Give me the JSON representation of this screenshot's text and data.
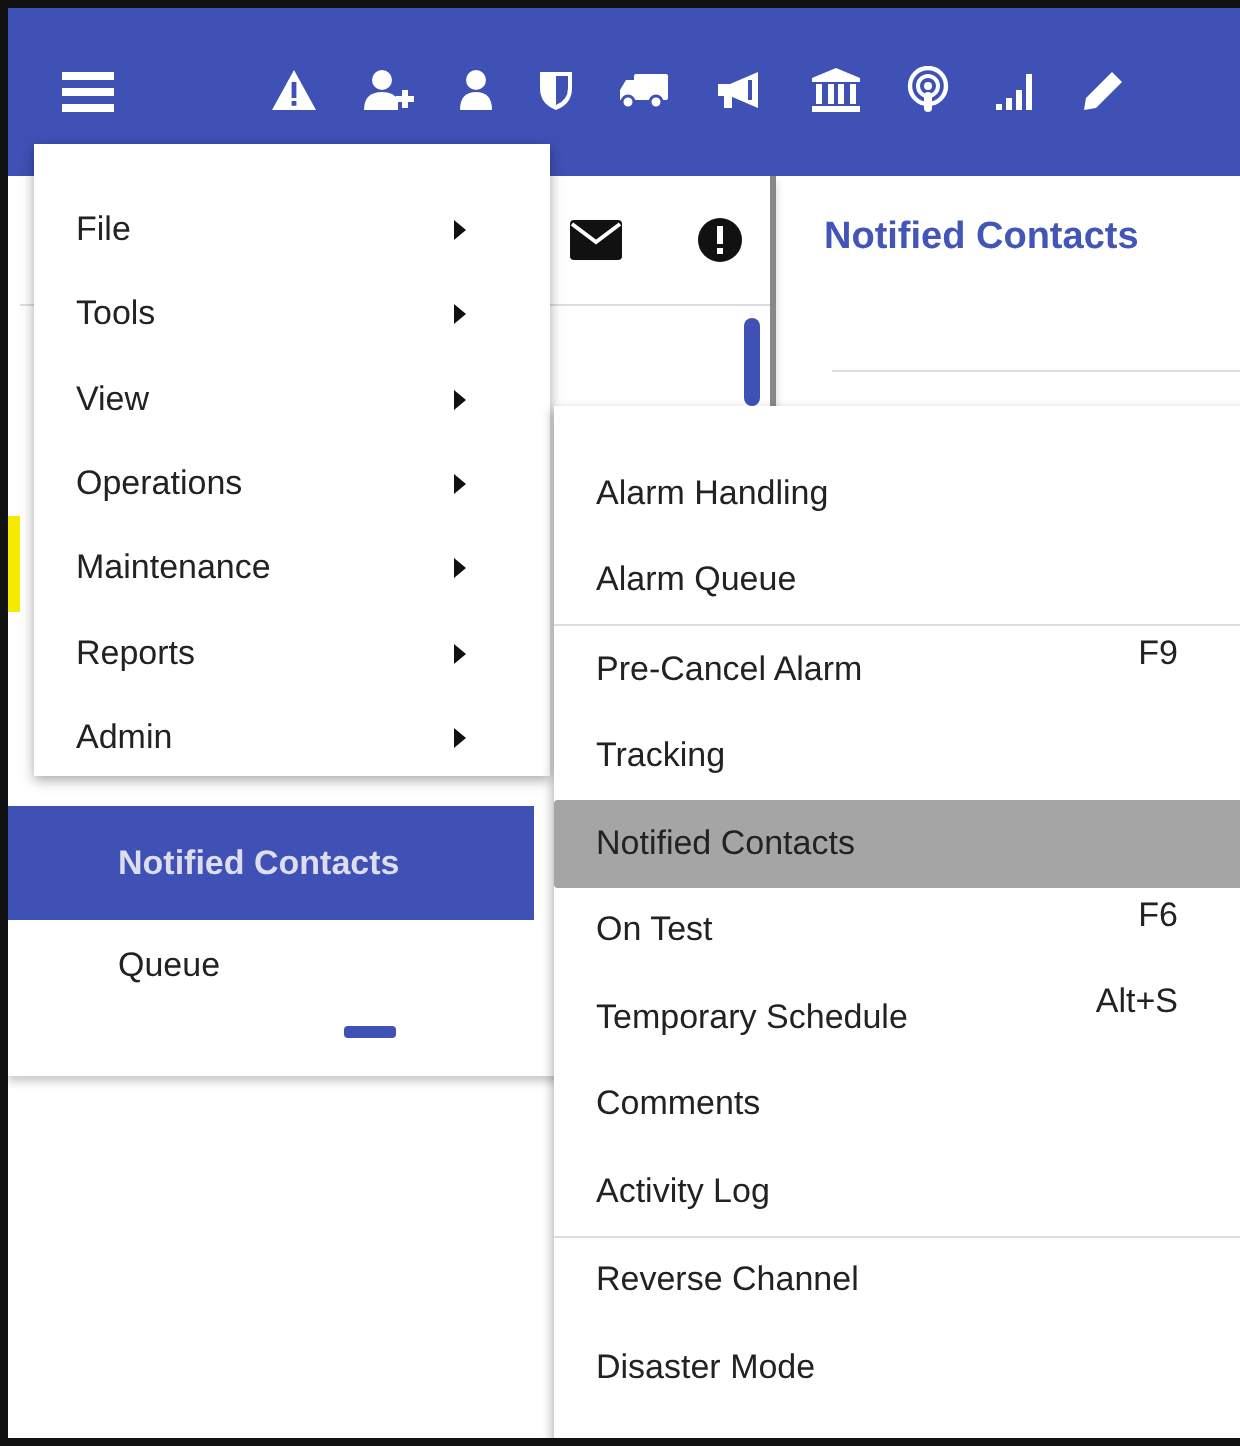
{
  "left_panel": {
    "rows": [
      {
        "label": "Notified Contacts",
        "selected": true
      },
      {
        "label": "Queue",
        "selected": false
      }
    ]
  },
  "right_panel": {
    "title": "Notified Contacts"
  },
  "main_menu": [
    {
      "label": "File"
    },
    {
      "label": "Tools"
    },
    {
      "label": "View"
    },
    {
      "label": "Operations"
    },
    {
      "label": "Maintenance"
    },
    {
      "label": "Reports"
    },
    {
      "label": "Admin"
    }
  ],
  "submenu": [
    [
      {
        "label": "Alarm Handling",
        "selected": false
      },
      {
        "label": "Alarm Queue",
        "selected": false
      }
    ],
    [
      {
        "label": "Pre-Cancel Alarm",
        "shortcut": "F9",
        "selected": false
      },
      {
        "label": "Tracking",
        "selected": false
      },
      {
        "label": "Notified Contacts",
        "selected": true
      },
      {
        "label": "On Test",
        "shortcut": "F6",
        "selected": false
      },
      {
        "label": "Temporary Schedule",
        "shortcut": "Alt+S",
        "selected": false
      },
      {
        "label": "Comments",
        "selected": false
      },
      {
        "label": "Activity Log",
        "selected": false
      }
    ],
    [
      {
        "label": "Reverse Channel",
        "selected": false
      },
      {
        "label": "Disaster Mode",
        "selected": false
      }
    ]
  ]
}
